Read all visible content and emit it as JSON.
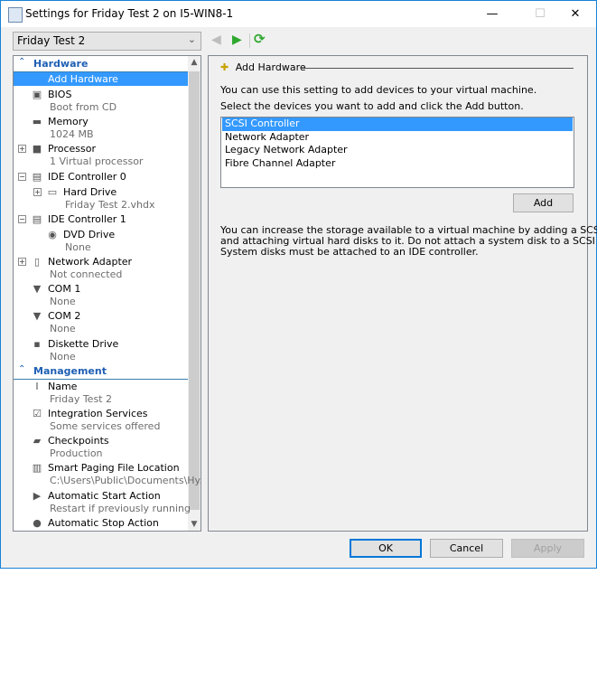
{
  "window": {
    "title": "Settings for Friday Test 2 on I5-WIN8-1",
    "minimize": "—",
    "maximize": "☐",
    "close": "✕"
  },
  "vm_selector": {
    "value": "Friday Test 2"
  },
  "nav": {
    "back": "◀",
    "forward": "▶",
    "refresh": "⟳"
  },
  "tree": {
    "sections": [
      {
        "label": "Hardware",
        "items": [
          {
            "label": "Add Hardware",
            "sub": "",
            "icon": "add-hardware-icon",
            "glyph": "✚",
            "selected": true,
            "indent": 0
          },
          {
            "label": "BIOS",
            "sub": "Boot from CD",
            "icon": "bios-icon",
            "glyph": "▣",
            "indent": 0
          },
          {
            "label": "Memory",
            "sub": "1024 MB",
            "icon": "memory-icon",
            "glyph": "▬",
            "indent": 0
          },
          {
            "label": "Processor",
            "sub": "1 Virtual processor",
            "icon": "processor-icon",
            "glyph": "■",
            "expander": "+",
            "indent": 0
          },
          {
            "label": "IDE Controller 0",
            "sub": "",
            "icon": "ide-controller-icon",
            "glyph": "▤",
            "expander": "−",
            "indent": 0
          },
          {
            "label": "Hard Drive",
            "sub": "Friday Test 2.vhdx",
            "icon": "hard-drive-icon",
            "glyph": "▭",
            "expander": "+",
            "indent": 1
          },
          {
            "label": "IDE Controller 1",
            "sub": "",
            "icon": "ide-controller-icon",
            "glyph": "▤",
            "expander": "−",
            "indent": 0
          },
          {
            "label": "DVD Drive",
            "sub": "None",
            "icon": "dvd-drive-icon",
            "glyph": "◉",
            "indent": 1
          },
          {
            "label": "Network Adapter",
            "sub": "Not connected",
            "icon": "network-adapter-icon",
            "glyph": "▯",
            "expander": "+",
            "indent": 0
          },
          {
            "label": "COM 1",
            "sub": "None",
            "icon": "com-port-icon",
            "glyph": "▼",
            "indent": 0
          },
          {
            "label": "COM 2",
            "sub": "None",
            "icon": "com-port-icon",
            "glyph": "▼",
            "indent": 0
          },
          {
            "label": "Diskette Drive",
            "sub": "None",
            "icon": "diskette-icon",
            "glyph": "▪",
            "indent": 0
          }
        ]
      },
      {
        "label": "Management",
        "items": [
          {
            "label": "Name",
            "sub": "Friday Test 2",
            "icon": "name-icon",
            "glyph": "I",
            "indent": 0
          },
          {
            "label": "Integration Services",
            "sub": "Some services offered",
            "icon": "integration-services-icon",
            "glyph": "☑",
            "indent": 0
          },
          {
            "label": "Checkpoints",
            "sub": "Production",
            "icon": "checkpoints-icon",
            "glyph": "▰",
            "indent": 0
          },
          {
            "label": "Smart Paging File Location",
            "sub": "C:\\Users\\Public\\Documents\\Hy...",
            "icon": "smart-paging-icon",
            "glyph": "▥",
            "indent": 0
          },
          {
            "label": "Automatic Start Action",
            "sub": "Restart if previously running",
            "icon": "auto-start-icon",
            "glyph": "▶",
            "indent": 0
          },
          {
            "label": "Automatic Stop Action",
            "sub": "",
            "icon": "auto-stop-icon",
            "glyph": "●",
            "indent": 0
          }
        ]
      }
    ]
  },
  "panel": {
    "heading": "Add Hardware",
    "intro": "You can use this setting to add devices to your virtual machine.",
    "select_prompt": "Select the devices you want to add and click the Add button.",
    "devices": [
      "SCSI Controller",
      "Network Adapter",
      "Legacy Network Adapter",
      "Fibre Channel Adapter"
    ],
    "selected_device": "SCSI Controller",
    "add_label": "Add",
    "note_lines": [
      "You can increase the storage available to a virtual machine by adding a SCSI controller",
      "and attaching virtual hard disks to it. Do not attach a system disk to a SCSI controller.",
      "System disks must be attached to an IDE controller."
    ]
  },
  "footer": {
    "ok": "OK",
    "cancel": "Cancel",
    "apply": "Apply"
  },
  "colors": {
    "selection": "#3399ff",
    "section_header": "#1e5fb4",
    "window_border": "#1883d7",
    "nav_forward": "#2ea82e"
  }
}
